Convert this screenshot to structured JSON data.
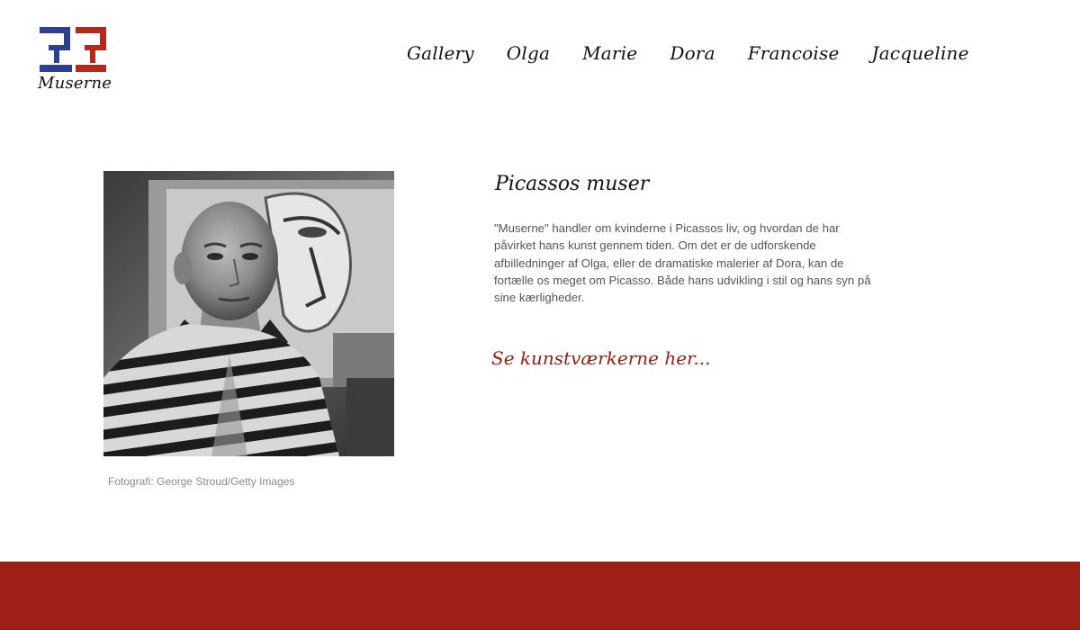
{
  "logo": {
    "wordmark": "Muserne",
    "colors": {
      "blue": "#2f3f8f",
      "red": "#b5281c"
    }
  },
  "nav": {
    "items": [
      {
        "label": "Gallery"
      },
      {
        "label": "Olga"
      },
      {
        "label": "Marie"
      },
      {
        "label": "Dora"
      },
      {
        "label": "Francoise"
      },
      {
        "label": "Jacqueline"
      }
    ]
  },
  "main": {
    "photo": {
      "caption": "Fotografi: George Stroud/Getty Images",
      "style": "black-and-white"
    },
    "title": "Picassos muser",
    "body": "\"Muserne\" handler om kvinderne i Picassos liv, og hvordan de har påvirket hans kunst gennem tiden. Om det er de udforskende afbilledninger af Olga, eller de dramatiske malerier af Dora, kan de fortælle os meget om Picasso. Både hans udvikling i stil og hans syn på sine kærligheder.",
    "cta": "Se kunstværkerne her..."
  },
  "colors": {
    "accent": "#9b1b12",
    "footer": "#9e1f16",
    "text": "#555555",
    "heading": "#111111"
  }
}
